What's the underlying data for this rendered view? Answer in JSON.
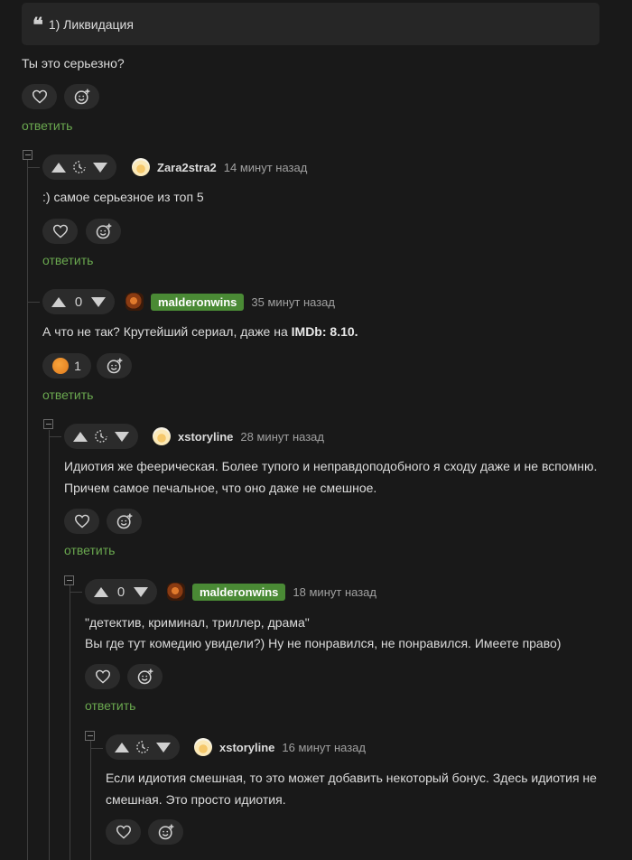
{
  "quote": {
    "text": "1) Ликвидация"
  },
  "comments": [
    {
      "text": "Ты это серьезно?",
      "reply": "ответить"
    },
    {
      "author": "Zara2stra2",
      "time": "14 минут назад",
      "score": "",
      "text": ":) самое серьезное из топ 5",
      "reply": "ответить"
    },
    {
      "author": "malderonwins",
      "time": "35 минут назад",
      "score": "0",
      "text_before": "А что не так? Крутейший сериал, даже на ",
      "text_bold": "IMDb: 8.10.",
      "reaction_count": "1",
      "reply": "ответить"
    },
    {
      "author": "xstoryline",
      "time": "28 минут назад",
      "score": "",
      "text_line1": "Идиотия же феерическая. Более тупого и неправдоподобного я сходу даже и не вспомню.",
      "text_line2": "Причем самое печальное, что оно даже не смешное.",
      "reply": "ответить"
    },
    {
      "author": "malderonwins",
      "time": "18 минут назад",
      "score": "0",
      "text_line1": "\"детектив, криминал, триллер, драма\"",
      "text_line2": "Вы где тут комедию увидели?) Ну не понравился, не понравился. Имеете право)",
      "reply": "ответить"
    },
    {
      "author": "xstoryline",
      "time": "16 минут назад",
      "score": "",
      "text_line1": "Если идиотия смешная, то это может добавить некоторый бонус. Здесь идиотия не",
      "text_line2": "смешная. Это просто идиотия."
    }
  ],
  "colors": {
    "background": "#191919",
    "accent_green": "#6aa84f",
    "tag_green": "#4a8a35",
    "pill": "#2b2b2b"
  },
  "icons": [
    "quote-icon",
    "heart-icon",
    "add-reaction-icon",
    "upvote-icon",
    "downvote-icon",
    "pending-score-icon",
    "collapse-icon"
  ]
}
